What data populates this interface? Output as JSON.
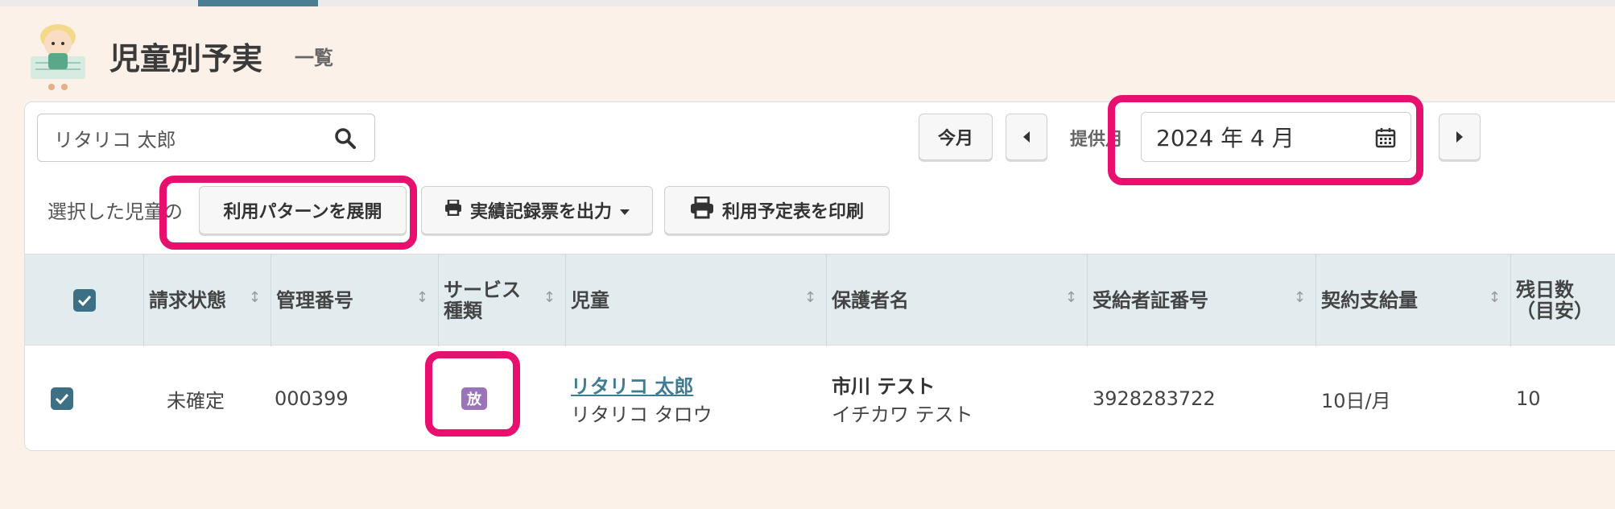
{
  "header": {
    "title": "児童別予実",
    "subtitle": "一覧"
  },
  "toolbar": {
    "search_value": "リタリコ 太郎",
    "this_month_label": "今月",
    "provision_label": "提供月",
    "month_value": "2024 年 4 月",
    "selected_children_label": "選択した児童の",
    "expand_pattern_label": "利用パターンを展開",
    "export_record_label": "実績記録票を出力",
    "print_schedule_label": "利用予定表を印刷"
  },
  "table": {
    "columns": [
      "請求状態",
      "管理番号",
      "サービス種類",
      "児童",
      "保護者名",
      "受給者証番号",
      "契約支給量",
      "残日数（目安）"
    ],
    "column_lines": {
      "service": [
        "サービス",
        "種類"
      ],
      "remaining": [
        "残日数",
        "（目安）"
      ]
    },
    "rows": [
      {
        "billing_status": "未確定",
        "management_no": "000399",
        "service_badge": "放",
        "child_name": "リタリコ 太郎",
        "child_kana": "リタリコ タロウ",
        "guardian_name": "市川 テスト",
        "guardian_kana": "イチカワ テスト",
        "certificate_no": "3928283722",
        "contract_amount": "10日/月",
        "remaining_days": "10"
      }
    ]
  },
  "colors": {
    "accent": "#3d7084",
    "highlight": "#e8106e",
    "service_badge": "#9a74b9",
    "background": "#fbf1e9"
  }
}
